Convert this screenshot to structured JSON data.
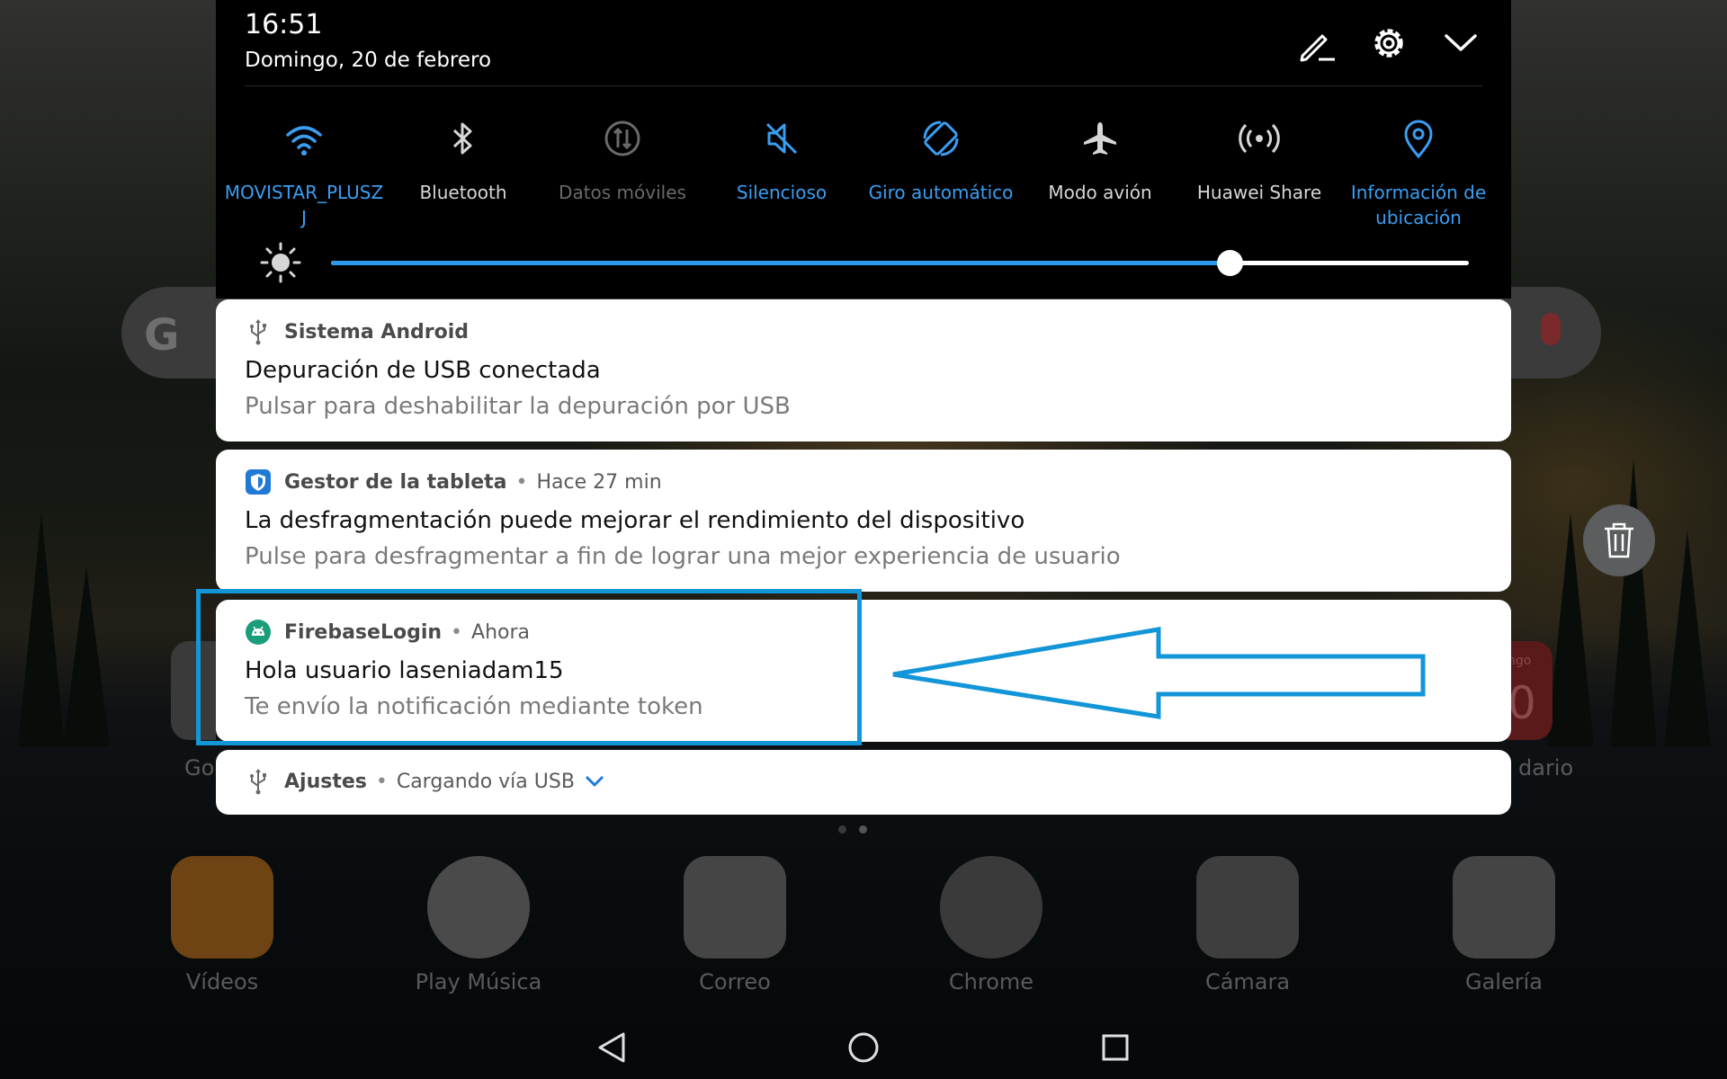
{
  "status": {
    "time": "16:51",
    "date": "Domingo, 20 de febrero"
  },
  "header_icons": [
    "edit-icon",
    "settings-gear-icon",
    "collapse-chevron-icon"
  ],
  "quick_settings": [
    {
      "label": "MOVISTAR_PLUSZ\nJ",
      "icon": "wifi-icon",
      "state": "on"
    },
    {
      "label": "Bluetooth",
      "icon": "bluetooth-icon",
      "state": "off"
    },
    {
      "label": "Datos móviles",
      "icon": "mobile-data-icon",
      "state": "disabled"
    },
    {
      "label": "Silencioso",
      "icon": "speaker-muted-icon",
      "state": "on"
    },
    {
      "label": "Giro automático",
      "icon": "auto-rotate-icon",
      "state": "on"
    },
    {
      "label": "Modo avión",
      "icon": "airplane-icon",
      "state": "off"
    },
    {
      "label": "Huawei Share",
      "icon": "huawei-share-icon",
      "state": "off"
    },
    {
      "label": "Información de\nubicación",
      "icon": "location-pin-icon",
      "state": "on"
    }
  ],
  "brightness": {
    "level": 0.79
  },
  "colors": {
    "accent": "#3a9ef2",
    "highlight": "#1396d8"
  },
  "notifications": [
    {
      "app": "Sistema Android",
      "time": "",
      "title": "Depuración de USB conectada",
      "text": "Pulsar para deshabilitar la depuración por USB",
      "icon": "usb-icon"
    },
    {
      "app": "Gestor de la tableta",
      "time": "Hace 27 min",
      "title": "La desfragmentación puede mejorar el rendimiento del dispositivo",
      "text": "Pulse para desfragmentar a fin de lograr una mejor experiencia de usuario",
      "icon": "shield-icon"
    },
    {
      "app": "FirebaseLogin",
      "time": "Ahora",
      "title": "Hola usuario laseniadam15",
      "text": "Te envío la notificación mediante token",
      "icon": "android-icon"
    },
    {
      "app": "Ajustes",
      "time": "Cargando vía USB",
      "icon": "usb-icon"
    }
  ],
  "home": {
    "dock": [
      "Vídeos",
      "Play Música",
      "Correo",
      "Chrome",
      "Cámara",
      "Galería"
    ],
    "side_labels": {
      "left": "Go",
      "right": "dario"
    },
    "widget_text": "ngo",
    "widget_digit": "0"
  },
  "navbar": [
    "back-icon",
    "home-icon",
    "recents-icon"
  ]
}
